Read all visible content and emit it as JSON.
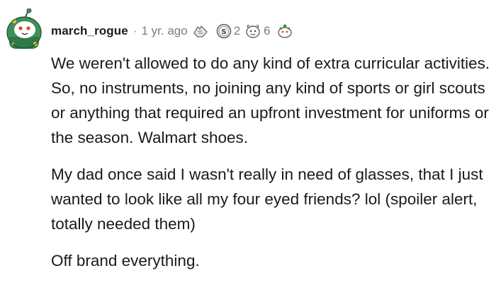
{
  "comment": {
    "username": "march_rogue",
    "separator": "·",
    "age": "1 yr. ago",
    "awards": [
      {
        "icon": "hands-award-icon",
        "count": ""
      },
      {
        "icon": "silver-coin-award-icon",
        "count": "2"
      },
      {
        "icon": "wholesome-award-icon",
        "count": "6"
      },
      {
        "icon": "helpful-award-icon",
        "count": ""
      }
    ],
    "paragraphs": [
      "We weren't allowed to do any kind of extra curricular activities. So, no instruments, no joining any kind of sports or girl scouts or anything that required an upfront investment for uniforms or the season. Walmart shoes.",
      "My dad once said I wasn't really in need of glasses, that I just wanted to look like all my four eyed friends? lol (spoiler alert, totally needed them)",
      "Off brand everything."
    ]
  },
  "colors": {
    "text": "#1a1a1b",
    "meta": "#7c7c7c",
    "avatar_green": "#3f8f5a"
  }
}
